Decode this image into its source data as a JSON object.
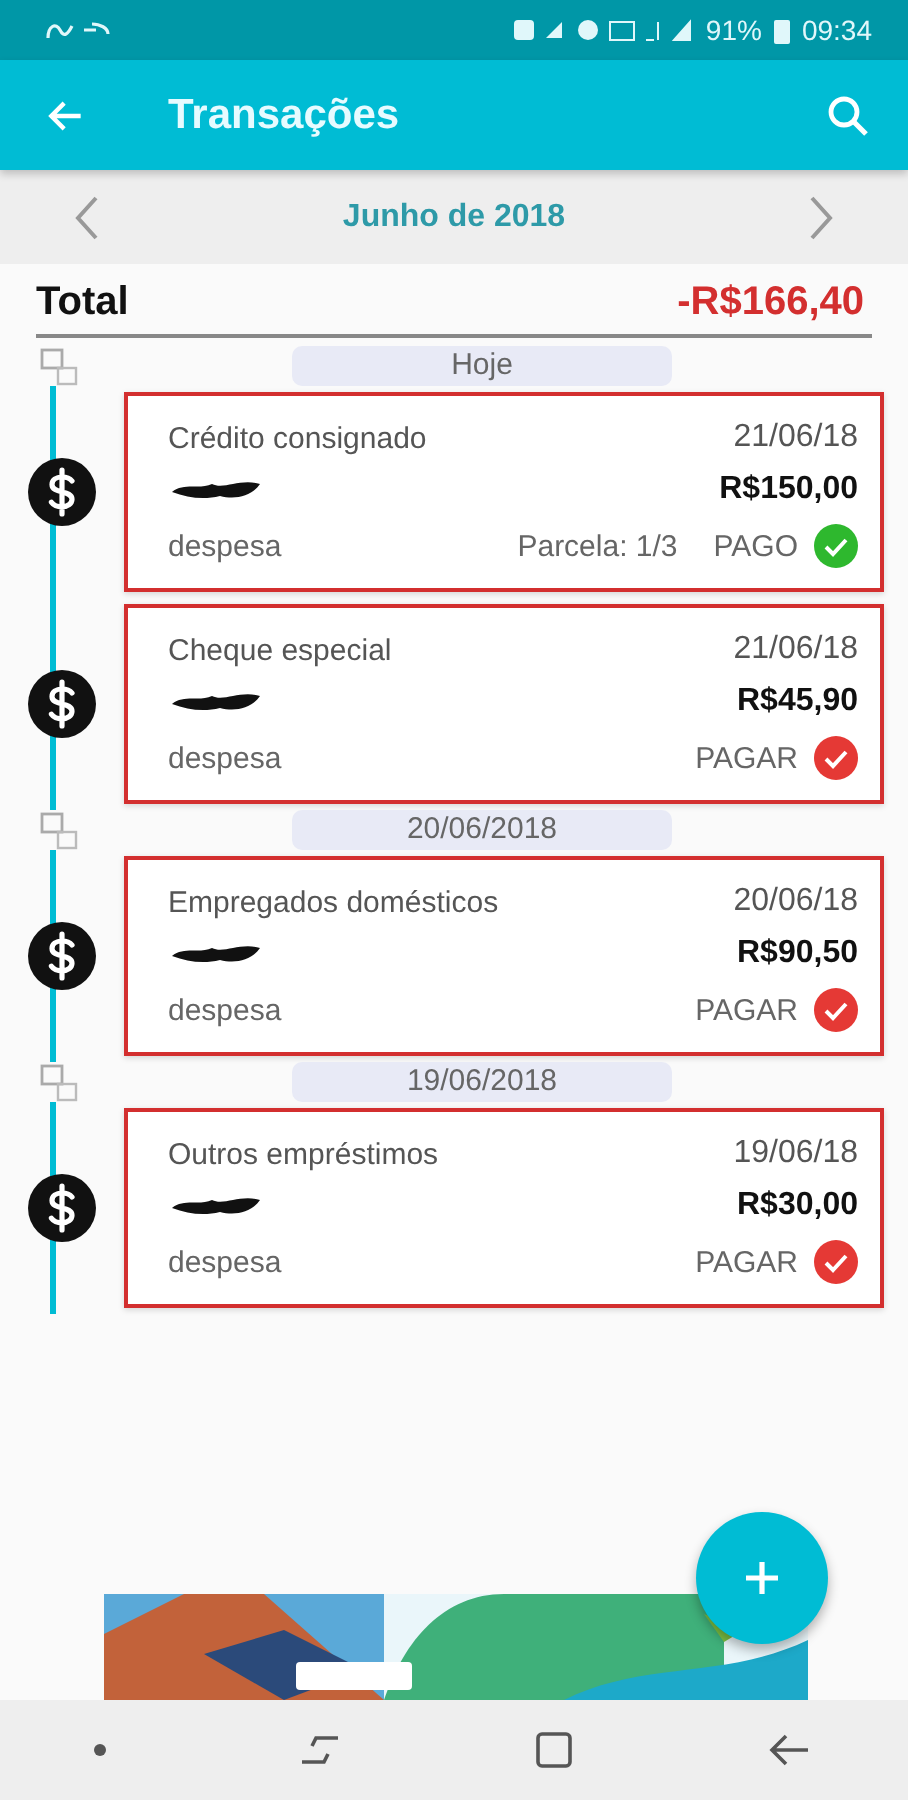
{
  "status_bar": {
    "battery": "91%",
    "time": "09:34"
  },
  "app_bar": {
    "title": "Transações"
  },
  "month_nav": {
    "label": "Junho de 2018"
  },
  "total": {
    "label": "Total",
    "amount": "-R$166,40"
  },
  "groups": [
    {
      "label": "Hoje",
      "items": [
        {
          "category": "Crédito consignado",
          "date": "21/06/18",
          "amount": "R$150,00",
          "type": "despesa",
          "installment": "Parcela: 1/3",
          "status": "PAGO",
          "paid": true
        },
        {
          "category": "Cheque especial",
          "date": "21/06/18",
          "amount": "R$45,90",
          "type": "despesa",
          "status": "PAGAR",
          "paid": false
        }
      ]
    },
    {
      "label": "20/06/2018",
      "items": [
        {
          "category": "Empregados domésticos",
          "date": "20/06/18",
          "amount": "R$90,50",
          "type": "despesa",
          "status": "PAGAR",
          "paid": false
        }
      ]
    },
    {
      "label": "19/06/2018",
      "items": [
        {
          "category": "Outros empréstimos",
          "date": "19/06/18",
          "amount": "R$30,00",
          "type": "despesa",
          "status": "PAGAR",
          "paid": false
        }
      ]
    }
  ]
}
